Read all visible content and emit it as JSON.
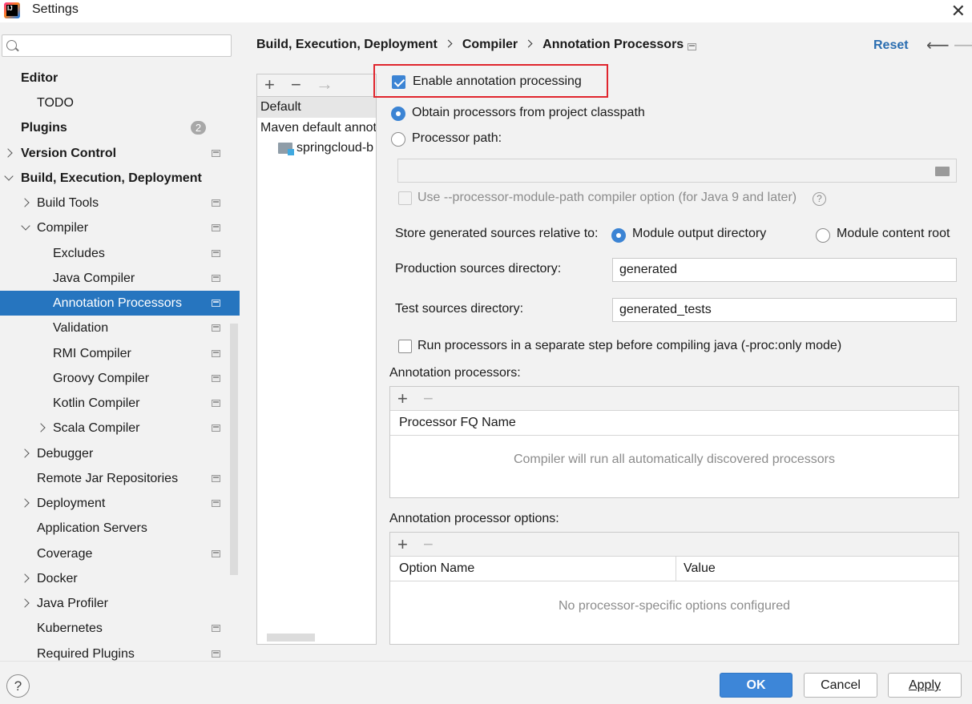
{
  "window": {
    "title": "Settings",
    "app_icon_letters": "IJ"
  },
  "sidebar": {
    "search_placeholder": "",
    "items": [
      {
        "label": "Editor",
        "bold": true
      },
      {
        "label": "TODO"
      },
      {
        "label": "Plugins",
        "bold": true,
        "badge": "2"
      },
      {
        "label": "Version Control",
        "bold": true
      },
      {
        "label": "Build, Execution, Deployment",
        "bold": true
      },
      {
        "label": "Build Tools"
      },
      {
        "label": "Compiler"
      },
      {
        "label": "Excludes"
      },
      {
        "label": "Java Compiler"
      },
      {
        "label": "Annotation Processors",
        "selected": true
      },
      {
        "label": "Validation"
      },
      {
        "label": "RMI Compiler"
      },
      {
        "label": "Groovy Compiler"
      },
      {
        "label": "Kotlin Compiler"
      },
      {
        "label": "Scala Compiler"
      },
      {
        "label": "Debugger"
      },
      {
        "label": "Remote Jar Repositories"
      },
      {
        "label": "Deployment"
      },
      {
        "label": "Application Servers"
      },
      {
        "label": "Coverage"
      },
      {
        "label": "Docker"
      },
      {
        "label": "Java Profiler"
      },
      {
        "label": "Kubernetes"
      },
      {
        "label": "Required Plugins"
      }
    ]
  },
  "breadcrumb": [
    "Build, Execution, Deployment",
    "Compiler",
    "Annotation Processors"
  ],
  "header": {
    "reset_label": "Reset"
  },
  "profiles": {
    "toolbar": {
      "add": "+",
      "remove": "−",
      "move": "→"
    },
    "rows": [
      "Default",
      "Maven default annotation processors profile",
      "springcloud-b"
    ]
  },
  "form": {
    "enable_annotation_processing": {
      "label": "Enable annotation processing",
      "checked": true
    },
    "obtain_from_classpath": {
      "label": "Obtain processors from project classpath",
      "selected": true
    },
    "processor_path": {
      "label": "Processor path:",
      "value": ""
    },
    "module_path_option": {
      "label": "Use --processor-module-path compiler option (for Java 9 and later)",
      "help": "?"
    },
    "store_relative_to": {
      "label": "Store generated sources relative to:",
      "options": [
        "Module output directory",
        "Module content root"
      ],
      "selected": "Module output directory"
    },
    "production_dir": {
      "label": "Production sources directory:",
      "value": "generated"
    },
    "test_dir": {
      "label": "Test sources directory:",
      "value": "generated_tests"
    },
    "separate_step": {
      "label": "Run processors in a separate step before compiling java (-proc:only mode)",
      "checked": false
    }
  },
  "processors_table": {
    "title": "Annotation processors:",
    "add": "+",
    "remove": "−",
    "column": "Processor FQ Name",
    "empty_text": "Compiler will run all automatically discovered processors"
  },
  "options_table": {
    "title": "Annotation processor options:",
    "add": "+",
    "remove": "−",
    "columns": [
      "Option Name",
      "Value"
    ],
    "empty_text": "No processor-specific options configured"
  },
  "footer": {
    "help": "?",
    "ok": "OK",
    "cancel": "Cancel",
    "apply": "Apply"
  },
  "colors": {
    "accent": "#2675bf",
    "highlight_border": "#e0252d",
    "link": "#2a6db0"
  }
}
